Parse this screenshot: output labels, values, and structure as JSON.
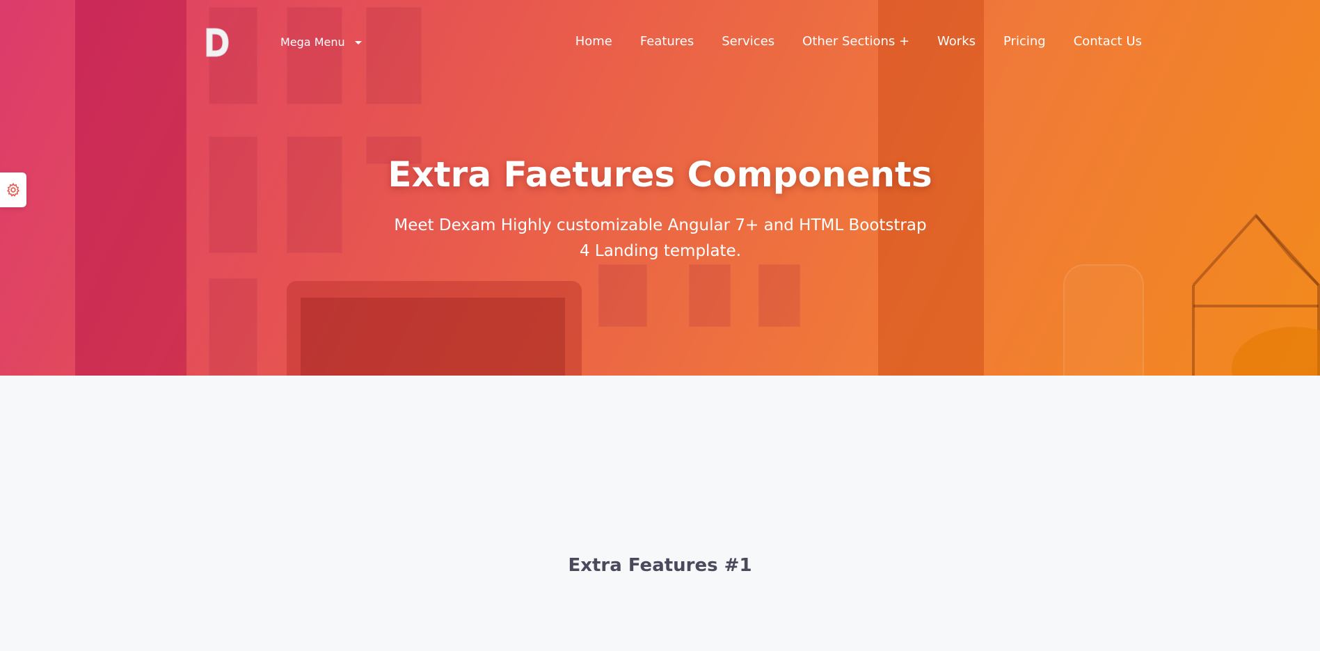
{
  "nav": {
    "mega_menu_label": "Mega Menu",
    "links": [
      "Home",
      "Features",
      "Services",
      "Other Sections +",
      "Works",
      "Pricing",
      "Contact Us"
    ]
  },
  "hero": {
    "title": "Extra Faetures Components",
    "subtitle": "Meet Dexam Highly customizable Angular 7+ and HTML Bootstrap 4 Landing template."
  },
  "section": {
    "title": "Extra Features #1"
  },
  "icons": {
    "logo": "logo-d-icon",
    "settings": "gear-icon",
    "caret": "chevron-down-icon"
  },
  "colors": {
    "gradient_start": "#dc3b6b",
    "gradient_end": "#f38a1c",
    "accent": "#e8584e",
    "page_bg": "#f7f8fa",
    "section_title": "#4a4a5c"
  }
}
